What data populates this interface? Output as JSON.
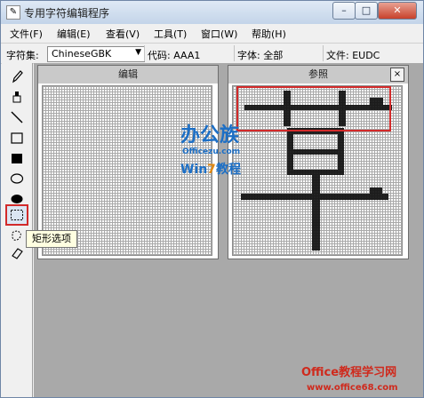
{
  "window": {
    "title": "专用字符编辑程序"
  },
  "titlebar_buttons": {
    "minimize": "–",
    "maximize": "□",
    "close": "✕"
  },
  "menu": [
    "文件(F)",
    "编辑(E)",
    "查看(V)",
    "工具(T)",
    "窗口(W)",
    "帮助(H)"
  ],
  "toolbar": {
    "charset_label": "字符集:",
    "charset_value": "ChineseGBK",
    "code": "代码: AAA1",
    "font": "字体: 全部",
    "file": "文件: EUDC"
  },
  "tools": [
    {
      "name": "pencil-icon"
    },
    {
      "name": "brush-icon"
    },
    {
      "name": "line-icon"
    },
    {
      "name": "hollow-rectangle-icon"
    },
    {
      "name": "filled-rectangle-icon"
    },
    {
      "name": "hollow-ellipse-icon"
    },
    {
      "name": "filled-ellipse-icon"
    },
    {
      "name": "rectangle-select-icon"
    },
    {
      "name": "freeform-select-icon"
    },
    {
      "name": "eraser-icon"
    }
  ],
  "tooltip": "矩形选项",
  "panels": {
    "edit_title": "编辑",
    "reference_title": "参照",
    "reference_close": "×"
  },
  "watermark": {
    "logo_text": "办公族",
    "logo_url": "Officezu.com",
    "logo_sub1": "Win",
    "logo_sub2": "7",
    "logo_sub3": "教程",
    "footer_line1": "Office教程学习网",
    "footer_line2": "www.office68.com"
  },
  "colors": {
    "highlight_red": "#d22a2a",
    "title_gradient_top": "#dfe9f5",
    "workspace": "#a9a9a9",
    "logo_blue": "#1c6fc6",
    "logo_orange": "#e38a12",
    "footer_red": "#cf2a1d"
  }
}
